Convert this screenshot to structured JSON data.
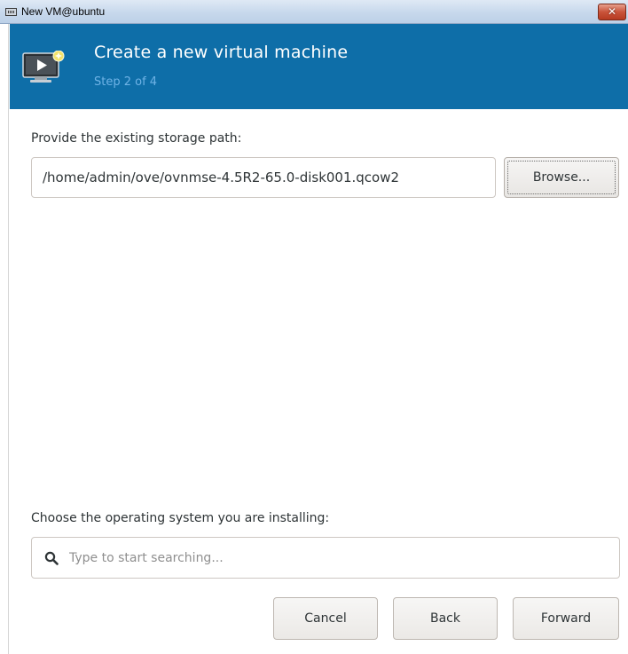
{
  "window": {
    "title": "New VM@ubuntu",
    "close_symbol": "✕",
    "app_icon": "vm-manager-icon"
  },
  "banner": {
    "icon": "vm-monitor-icon",
    "title": "Create a new virtual machine",
    "step": "Step 2 of 4",
    "background_color": "#0e6ea8",
    "step_color": "#6fb3e6"
  },
  "storage": {
    "label": "Provide the existing storage path:",
    "path_value": "/home/admin/ove/ovnmse-4.5R2-65.0-disk001.qcow2",
    "browse_label": "Browse..."
  },
  "os": {
    "label": "Choose the operating system you are installing:",
    "search_placeholder": "Type to start searching...",
    "search_icon": "search-icon"
  },
  "footer": {
    "cancel_label": "Cancel",
    "back_label": "Back",
    "forward_label": "Forward"
  }
}
